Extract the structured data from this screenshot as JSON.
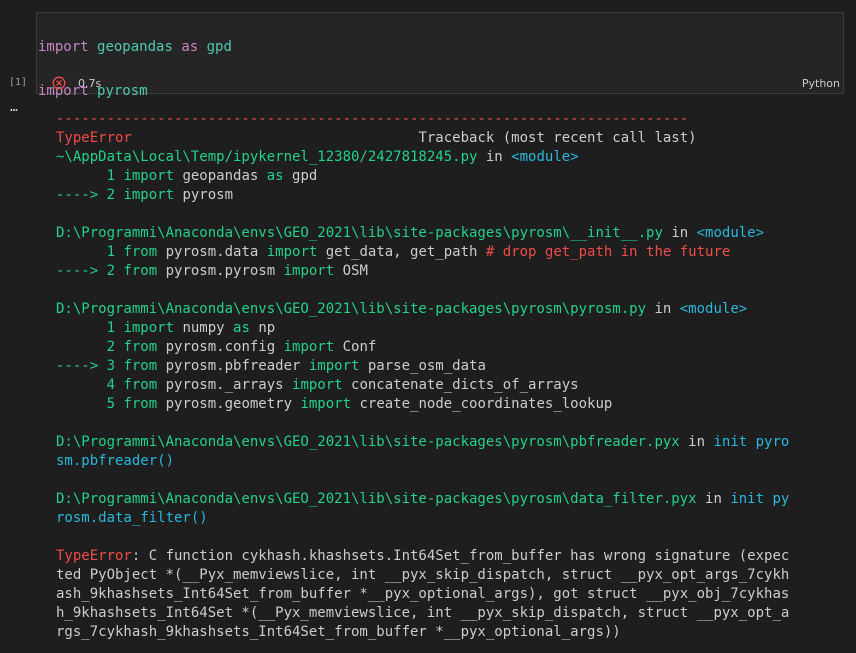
{
  "cell": {
    "code_lines": [
      {
        "kw1": "import",
        "mod": "geopandas",
        "kw2": "as",
        "alias": "gpd"
      },
      {
        "kw1": "import",
        "mod": "pyrosm",
        "kw2": "",
        "alias": ""
      }
    ],
    "execution_count": "[1]",
    "exec_time": "0.7s",
    "language": "Python",
    "status_icon": "error-circle-icon"
  },
  "output": {
    "dashes": "---------------------------------------------------------------------------",
    "error_type": "TypeError",
    "traceback_header": "Traceback (most recent call last)",
    "frames": [
      {
        "path": "~\\AppData\\Local\\Temp/ipykernel_12380/2427818245.py",
        "in": "in",
        "func": "<module>",
        "lines": [
          {
            "prefix": "      1 ",
            "parts": [
              [
                "kw",
                "import"
              ],
              [
                "t",
                " geopandas "
              ],
              [
                "kw",
                "as"
              ],
              [
                "t",
                " gpd"
              ]
            ]
          },
          {
            "prefix": "----> 2 ",
            "parts": [
              [
                "kw",
                "import"
              ],
              [
                "t",
                " pyrosm"
              ]
            ]
          }
        ]
      },
      {
        "path": "D:\\Programmi\\Anaconda\\envs\\GEO_2021\\lib\\site-packages\\pyrosm\\__init__.py",
        "in": "in",
        "func": "<module>",
        "lines": [
          {
            "prefix": "      1 ",
            "parts": [
              [
                "kw",
                "from"
              ],
              [
                "t",
                " pyrosm.data "
              ],
              [
                "kw",
                "import"
              ],
              [
                "t",
                " get_data, get_path "
              ],
              [
                "cm",
                "# drop get_path in the future"
              ]
            ]
          },
          {
            "prefix": "----> 2 ",
            "parts": [
              [
                "kw",
                "from"
              ],
              [
                "t",
                " pyrosm.pyrosm "
              ],
              [
                "kw",
                "import"
              ],
              [
                "t",
                " OSM"
              ]
            ]
          }
        ]
      },
      {
        "path": "D:\\Programmi\\Anaconda\\envs\\GEO_2021\\lib\\site-packages\\pyrosm\\pyrosm.py",
        "in": "in",
        "func": "<module>",
        "lines": [
          {
            "prefix": "      1 ",
            "parts": [
              [
                "kw",
                "import"
              ],
              [
                "t",
                " numpy "
              ],
              [
                "kw",
                "as"
              ],
              [
                "t",
                " np"
              ]
            ]
          },
          {
            "prefix": "      2 ",
            "parts": [
              [
                "kw",
                "from"
              ],
              [
                "t",
                " pyrosm.config "
              ],
              [
                "kw",
                "import"
              ],
              [
                "t",
                " Conf"
              ]
            ]
          },
          {
            "prefix": "----> 3 ",
            "parts": [
              [
                "kw",
                "from"
              ],
              [
                "t",
                " pyrosm.pbfreader "
              ],
              [
                "kw",
                "import"
              ],
              [
                "t",
                " parse_osm_data"
              ]
            ]
          },
          {
            "prefix": "      4 ",
            "parts": [
              [
                "kw",
                "from"
              ],
              [
                "t",
                " pyrosm._arrays "
              ],
              [
                "kw",
                "import"
              ],
              [
                "t",
                " concatenate_dicts_of_arrays"
              ]
            ]
          },
          {
            "prefix": "      5 ",
            "parts": [
              [
                "kw",
                "from"
              ],
              [
                "t",
                " pyrosm.geometry "
              ],
              [
                "kw",
                "import"
              ],
              [
                "t",
                " create_node_coordinates_lookup"
              ]
            ]
          }
        ]
      },
      {
        "path": "D:\\Programmi\\Anaconda\\envs\\GEO_2021\\lib\\site-packages\\pyrosm\\pbfreader.pyx",
        "in": "in",
        "func": "init pyro\nsm.pbfreader()",
        "lines": []
      },
      {
        "path": "D:\\Programmi\\Anaconda\\envs\\GEO_2021\\lib\\site-packages\\pyrosm\\data_filter.pyx",
        "in": "in",
        "func": "init py\nrosm.data_filter()",
        "lines": []
      }
    ],
    "final_error_type": "TypeError",
    "final_message": ": C function cykhash.khashsets.Int64Set_from_buffer has wrong signature (expec\nted PyObject *(__Pyx_memviewslice, int __pyx_skip_dispatch, struct __pyx_opt_args_7cykh\nash_9khashsets_Int64Set_from_buffer *__pyx_optional_args), got struct __pyx_obj_7cykhas\nh_9khashsets_Int64Set *(__Pyx_memviewslice, int __pyx_skip_dispatch, struct __pyx_opt_a\nrgs_7cykhash_9khashsets_Int64Set_from_buffer *__pyx_optional_args))"
  },
  "more_icon": "ellipsis-icon",
  "colors": {
    "background": "#1e1e1e",
    "error_red": "#f14c4c",
    "path_green": "#23d18b",
    "link_blue": "#3b8eea",
    "keyword_green": "#0dbc79"
  }
}
